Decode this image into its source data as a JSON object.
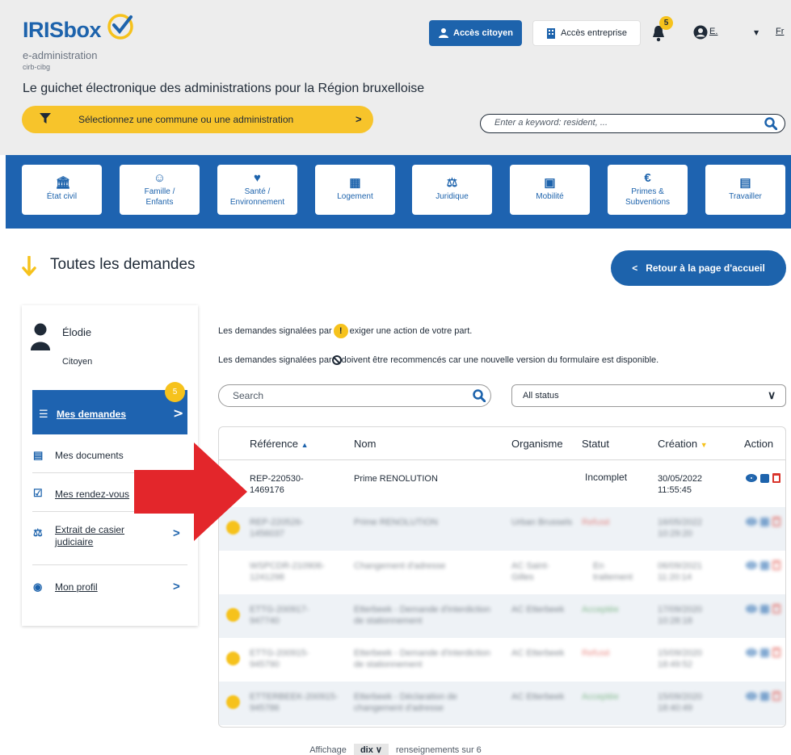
{
  "header": {
    "logo_text": "IRISbox",
    "logo_sub": "e-administration",
    "logo_sub2": "cirb-cibg",
    "tagline": "Le guichet électronique des administrations pour la Région bruxelloise",
    "citizen_label": "Accès citoyen",
    "enterprise_label": "Accès entreprise",
    "notification_count": "5",
    "user_initial": "E.",
    "language": "Fr",
    "commune_label": "Sélectionnez une commune ou une administration",
    "search_placeholder": "Enter a keyword: resident, ..."
  },
  "categories": [
    {
      "icon": "bank-icon",
      "label1": "État civil",
      "label2": ""
    },
    {
      "icon": "family-icon",
      "label1": "Famille /",
      "label2": "Enfants"
    },
    {
      "icon": "heart-icon",
      "label1": "Santé /",
      "label2": "Environnement"
    },
    {
      "icon": "building-icon",
      "label1": "Logement",
      "label2": ""
    },
    {
      "icon": "scale-icon",
      "label1": "Juridique",
      "label2": ""
    },
    {
      "icon": "bus-icon",
      "label1": "Mobilité",
      "label2": ""
    },
    {
      "icon": "euro-icon",
      "label1": "Primes &",
      "label2": "Subventions"
    },
    {
      "icon": "briefcase-icon",
      "label1": "Travailler",
      "label2": ""
    }
  ],
  "page": {
    "title": "Toutes les demandes",
    "back_label": "Retour à la page d'accueil"
  },
  "sidebar": {
    "user_name": "Élodie",
    "user_role": "Citoyen",
    "badge": "5",
    "items": [
      {
        "label": "Mes demandes"
      },
      {
        "label": "Mes documents"
      },
      {
        "label": "Mes rendez-vous"
      },
      {
        "label": "Extrait de casier",
        "label2": "judiciaire"
      },
      {
        "label": "Mon profil"
      }
    ]
  },
  "info": {
    "line1_before": "Les demandes signalées par",
    "line1_after": "exiger une action de votre part.",
    "line2_before": "Les demandes signalées par",
    "line2_after": "doivent être recommencés car une nouvelle version du formulaire est disponible."
  },
  "filters": {
    "search_placeholder": "Search",
    "status_value": "All status"
  },
  "table": {
    "headers": [
      "Référence",
      "Nom",
      "Organisme",
      "Statut",
      "Création",
      "Action"
    ],
    "rows": [
      {
        "ref1": "REP-220530-",
        "ref2": "1469176",
        "nom1": "Prime RENOLUTION",
        "nom2": "",
        "org1": "",
        "org2": "",
        "statut1": "Incomplet",
        "statut2": "",
        "date": "30/05/2022",
        "time": "11:55:45",
        "blur": false
      },
      {
        "ref1": "REP-220526-",
        "ref2": "1456037",
        "nom1": "Prime RENOLUTION",
        "nom2": "",
        "org1": "Urban Brussels",
        "org2": "",
        "statut1": "Refusé",
        "statut2": "",
        "date": "16/05/2022",
        "time": "10:29:20",
        "blur": true
      },
      {
        "ref1": "WSPCDR-210906-",
        "ref2": "1241298",
        "nom1": "Changement d'adresse",
        "nom2": "",
        "org1": "AC Saint-",
        "org2": "Gilles",
        "statut1": "En",
        "statut2": "traitement",
        "date": "06/09/2021",
        "time": "11:20:14",
        "blur": true
      },
      {
        "ref1": "ETTG-200917-",
        "ref2": "947740",
        "nom1": "Etterbeek - Demande d'interdiction",
        "nom2": "de stationnement",
        "org1": "AC Etterbeek",
        "org2": "",
        "statut1": "Acceptée",
        "statut2": "",
        "date": "17/09/2020",
        "time": "10:28:18",
        "blur": true
      },
      {
        "ref1": "ETTG-200915-",
        "ref2": "945790",
        "nom1": "Etterbeek - Demande d'interdiction",
        "nom2": "de stationnement",
        "org1": "AC Etterbeek",
        "org2": "",
        "statut1": "Refusé",
        "statut2": "",
        "date": "15/09/2020",
        "time": "18:49:52",
        "blur": true
      },
      {
        "ref1": "ETTERBEEK-200915-",
        "ref2": "945786",
        "nom1": "Etterbeek - Déclaration de",
        "nom2": "changement d'adresse",
        "org1": "AC Etterbeek",
        "org2": "",
        "statut1": "Acceptée",
        "statut2": "",
        "date": "15/09/2020",
        "time": "18:40:49",
        "blur": true
      }
    ]
  },
  "footer": {
    "prefix": "Affichage",
    "per_page": "dix",
    "suffix": "renseignements sur 6"
  },
  "colors": {
    "brand_blue": "#1d63ac",
    "accent_yellow": "#f6c21c",
    "arrow_red": "#e3262b"
  }
}
